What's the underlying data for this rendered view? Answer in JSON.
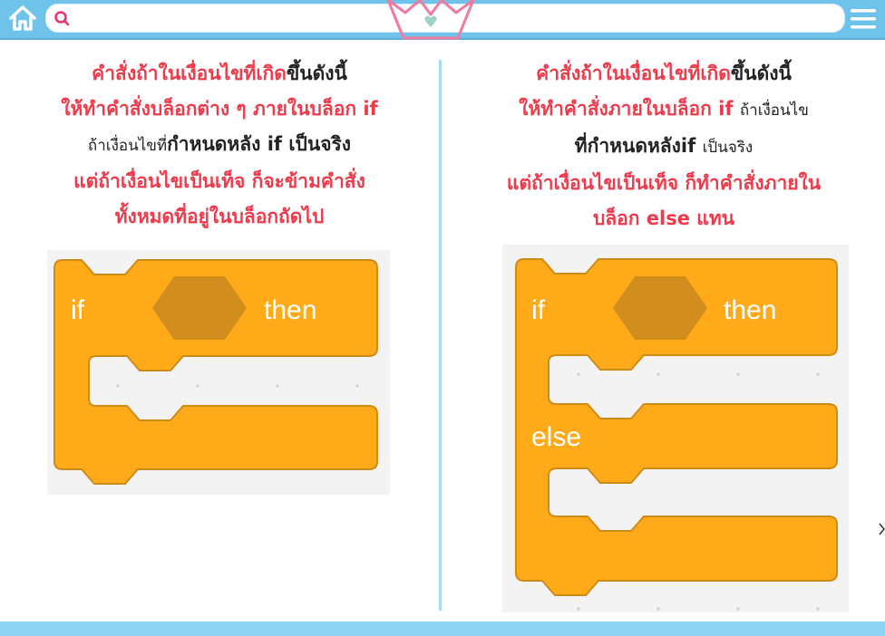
{
  "search": {
    "value": "",
    "placeholder": ""
  },
  "left_panel": {
    "line1_red": "คำสั่งถ้าในเงื่อนไขที่เกิด",
    "line1_black": "ขึ้นดังนี้",
    "line2": "ให้ทำคำสั่งบล็อกต่าง ๆ ภายในบล็อก if",
    "line3_thin": "ถ้าเงื่อนไขที่",
    "line3_bold": "กำหนดหลัง if เป็นจริง",
    "line4": "แต่ถ้าเงื่อนไขเป็นเท็จ ก็จะข้ามคำสั่ง",
    "line5": "ทั้งหมดที่อยู่ในบล็อกถัดไป",
    "block": {
      "if_label": "if",
      "then_label": "then"
    }
  },
  "right_panel": {
    "line1_red": "คำสั่งถ้าในเงื่อนไขที่เกิด",
    "line1_black": "ขึ้นดังนี้",
    "line2_red": "ให้ทำคำสั่งภายในบล็อก if",
    "line2_thin": "ถ้าเงื่อนไข",
    "line3_bold": "ที่กำหนดหลังif",
    "line3_thin": "เป็นจริง",
    "line4": "แต่ถ้าเงื่อนไขเป็นเท็จ ก็ทำคำสั่งภายใน",
    "line5": "บล็อก else แทน",
    "block": {
      "if_label": "if",
      "then_label": "then",
      "else_label": "else"
    }
  },
  "colors": {
    "topbar": "#6fc3ea",
    "bottombar": "#8fd3f3",
    "accent_red": "#ee3a4a",
    "block_orange": "#ffab19",
    "block_outline": "#cf8b17",
    "condition_hexagon": "#d18e1c"
  },
  "icons": [
    "home-icon",
    "search-icon",
    "crown-icon",
    "menu-icon",
    "chevron-right-icon"
  ]
}
